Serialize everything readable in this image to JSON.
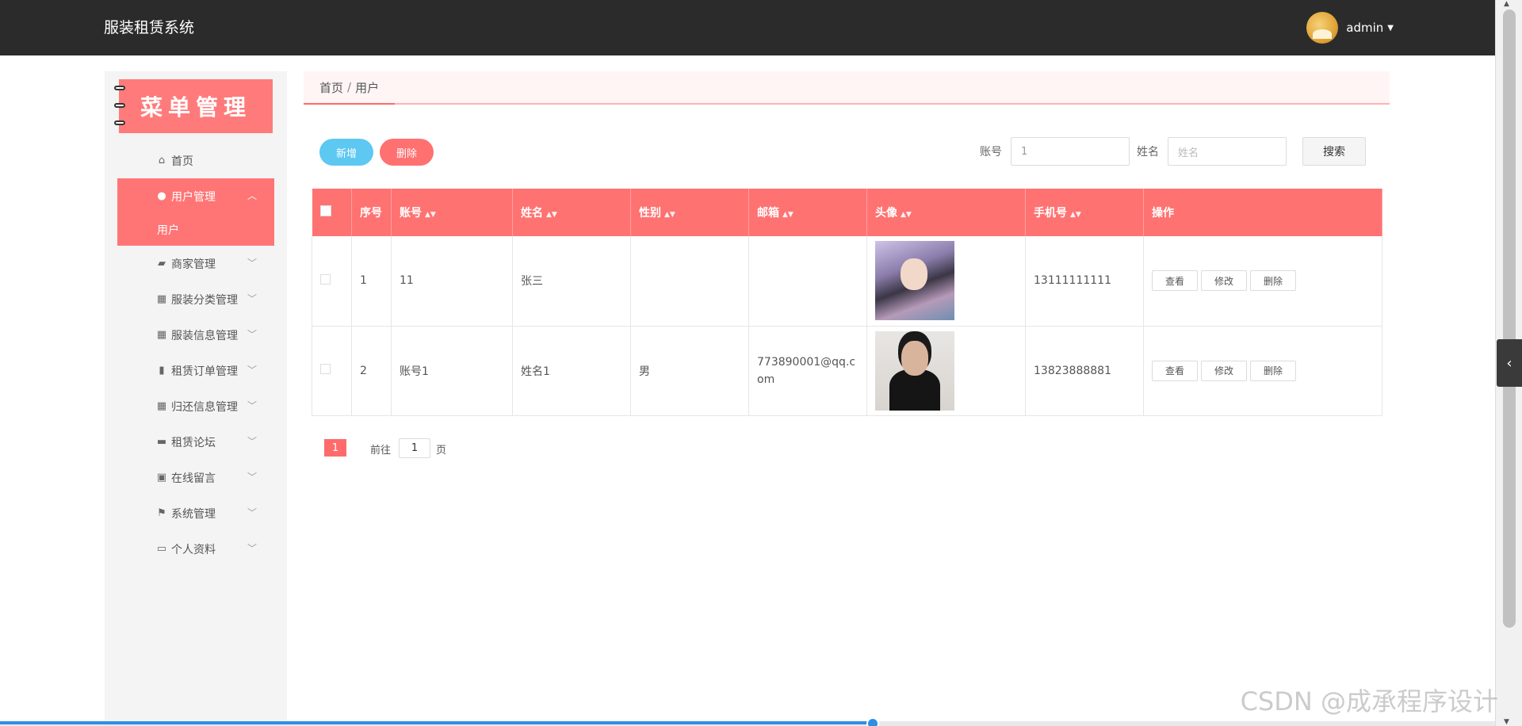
{
  "header": {
    "title": "服装租赁系统",
    "username": "admin"
  },
  "sidebar": {
    "banner": "菜单管理",
    "items": [
      {
        "label": "首页",
        "icon": "home-icon"
      },
      {
        "label": "用户管理",
        "icon": "user-icon",
        "active": true,
        "submenu": [
          "用户"
        ]
      },
      {
        "label": "商家管理",
        "icon": "shop-icon"
      },
      {
        "label": "服装分类管理",
        "icon": "grid-icon"
      },
      {
        "label": "服装信息管理",
        "icon": "grid-icon"
      },
      {
        "label": "租赁订单管理",
        "icon": "bar-chart-icon"
      },
      {
        "label": "归还信息管理",
        "icon": "grid-icon"
      },
      {
        "label": "租赁论坛",
        "icon": "monitor-icon"
      },
      {
        "label": "在线留言",
        "icon": "clipboard-icon"
      },
      {
        "label": "系统管理",
        "icon": "flag-icon"
      },
      {
        "label": "个人资料",
        "icon": "card-icon"
      }
    ]
  },
  "breadcrumb": {
    "home": "首页",
    "separator": "/",
    "current": "用户"
  },
  "toolbar": {
    "add_label": "新增",
    "delete_label": "删除"
  },
  "search": {
    "account_label": "账号",
    "account_value": "1",
    "name_label": "姓名",
    "name_placeholder": "姓名",
    "button_label": "搜索"
  },
  "table": {
    "headers": [
      "序号",
      "账号",
      "姓名",
      "性别",
      "邮箱",
      "头像",
      "手机号",
      "操作"
    ],
    "rows": [
      {
        "index": "1",
        "account": "11",
        "name": "张三",
        "gender": "",
        "email": "",
        "phone": "13111111111"
      },
      {
        "index": "2",
        "account": "账号1",
        "name": "姓名1",
        "gender": "男",
        "email": "773890001@qq.com",
        "phone": "13823888881"
      }
    ],
    "actions": {
      "view": "查看",
      "edit": "修改",
      "delete": "删除"
    }
  },
  "pagination": {
    "current_page": "1",
    "goto_label": "前往",
    "goto_value": "1",
    "page_suffix": "页"
  },
  "watermark": "CSDN @成承程序设计",
  "colors": {
    "header_bg": "#2b2b2b",
    "accent": "#ff7272",
    "add_button": "#5dc8f2"
  }
}
